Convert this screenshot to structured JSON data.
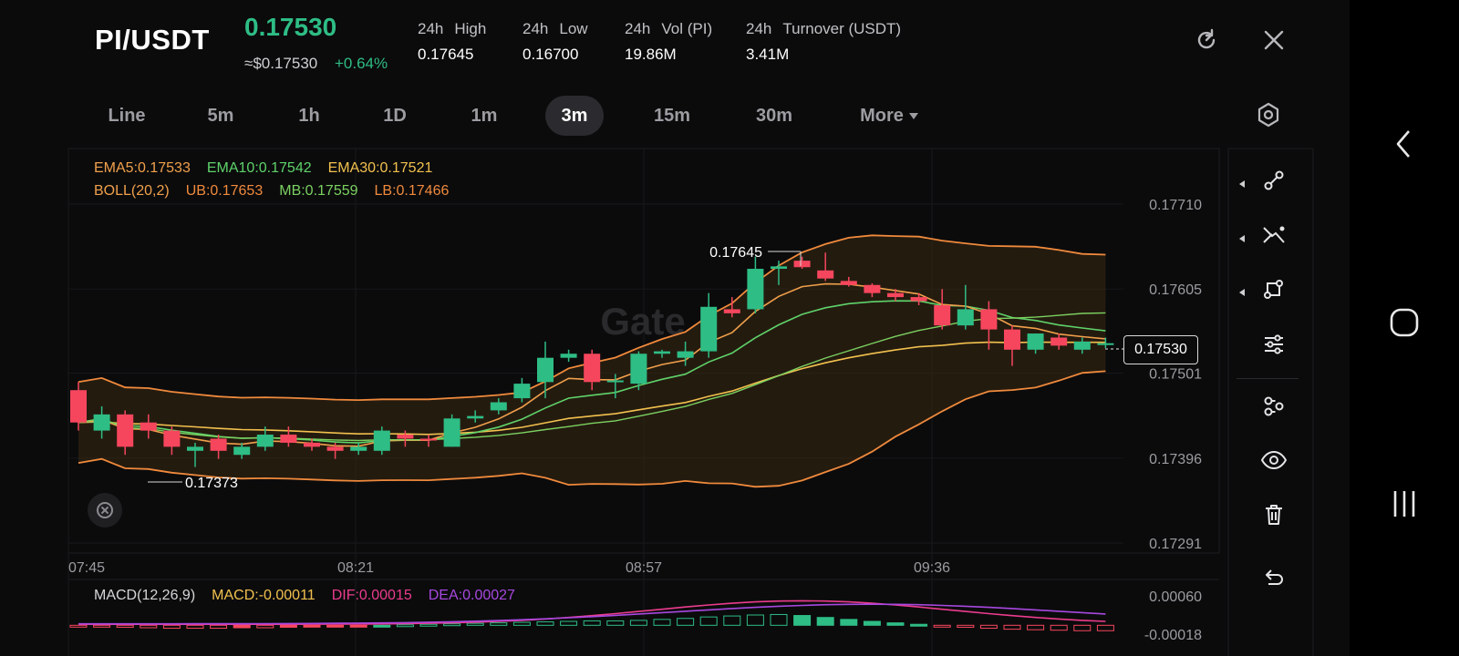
{
  "header": {
    "pair": "PI/USDT",
    "last_price": "0.17530",
    "approx_usd": "≈$0.17530",
    "change": "+0.64%",
    "stats": [
      {
        "label_a": "24h",
        "label_b": "High",
        "value": "0.17645"
      },
      {
        "label_a": "24h",
        "label_b": "Low",
        "value": "0.16700"
      },
      {
        "label_a": "24h",
        "label_b": "Vol (PI)",
        "value": "19.86M"
      },
      {
        "label_a": "24h",
        "label_b": "Turnover (USDT)",
        "value": "3.41M"
      }
    ],
    "icons": [
      "refresh-icon",
      "close-icon"
    ]
  },
  "tabs": {
    "items": [
      "Line",
      "5m",
      "1h",
      "1D",
      "1m",
      "3m",
      "15m",
      "30m",
      "More"
    ],
    "active": "3m"
  },
  "indicators": {
    "ema5": "EMA5:0.17533",
    "ema10": "EMA10:0.17542",
    "ema30": "EMA30:0.17521",
    "boll": "BOLL(20,2)",
    "ub": "UB:0.17653",
    "mb": "MB:0.17559",
    "lb": "LB:0.17466",
    "macd_name": "MACD(12,26,9)",
    "macd": "MACD:-0.00011",
    "dif": "DIF:0.00015",
    "dea": "DEA:0.00027"
  },
  "chart_data": {
    "type": "candlestick",
    "y_ticks": [
      "0.17710",
      "0.17605",
      "0.17501",
      "0.17396",
      "0.17291"
    ],
    "x_ticks": [
      "07:45",
      "08:21",
      "08:57",
      "09:36"
    ],
    "macd_ticks": [
      "0.00060",
      "-0.00018"
    ],
    "high_marker": "0.17645",
    "low_marker": "0.17373",
    "current_price": "0.17530",
    "watermark": "Gate",
    "colors": {
      "up": "#2ebd85",
      "down": "#f6465d",
      "ema5": "#f0a04b",
      "ema10": "#5fd36a",
      "ema30": "#f2c14e",
      "dif": "#ec3c8e",
      "dea": "#a848e0"
    },
    "candles": [
      {
        "o": 0.1748,
        "h": 0.1749,
        "l": 0.1743,
        "c": 0.1744
      },
      {
        "o": 0.1743,
        "h": 0.1746,
        "l": 0.1742,
        "c": 0.1745
      },
      {
        "o": 0.1745,
        "h": 0.17455,
        "l": 0.174,
        "c": 0.1741
      },
      {
        "o": 0.1744,
        "h": 0.1745,
        "l": 0.1742,
        "c": 0.1743
      },
      {
        "o": 0.1743,
        "h": 0.17435,
        "l": 0.174,
        "c": 0.1741
      },
      {
        "o": 0.17405,
        "h": 0.17415,
        "l": 0.17385,
        "c": 0.1741
      },
      {
        "o": 0.1742,
        "h": 0.17425,
        "l": 0.17395,
        "c": 0.17405
      },
      {
        "o": 0.174,
        "h": 0.17415,
        "l": 0.17395,
        "c": 0.1741
      },
      {
        "o": 0.1741,
        "h": 0.17435,
        "l": 0.17405,
        "c": 0.17425
      },
      {
        "o": 0.17425,
        "h": 0.17435,
        "l": 0.1741,
        "c": 0.17415
      },
      {
        "o": 0.17415,
        "h": 0.1742,
        "l": 0.17405,
        "c": 0.1741
      },
      {
        "o": 0.1741,
        "h": 0.17415,
        "l": 0.17395,
        "c": 0.17405
      },
      {
        "o": 0.17405,
        "h": 0.17415,
        "l": 0.174,
        "c": 0.1741
      },
      {
        "o": 0.17405,
        "h": 0.17435,
        "l": 0.174,
        "c": 0.1743
      },
      {
        "o": 0.17425,
        "h": 0.1743,
        "l": 0.1741,
        "c": 0.1742
      },
      {
        "o": 0.1742,
        "h": 0.17425,
        "l": 0.1741,
        "c": 0.17418
      },
      {
        "o": 0.1741,
        "h": 0.1745,
        "l": 0.1741,
        "c": 0.17445
      },
      {
        "o": 0.17445,
        "h": 0.17455,
        "l": 0.1744,
        "c": 0.17448
      },
      {
        "o": 0.17455,
        "h": 0.1747,
        "l": 0.1745,
        "c": 0.17465
      },
      {
        "o": 0.1747,
        "h": 0.17495,
        "l": 0.17465,
        "c": 0.17488
      },
      {
        "o": 0.1749,
        "h": 0.1754,
        "l": 0.1747,
        "c": 0.1752
      },
      {
        "o": 0.1752,
        "h": 0.1753,
        "l": 0.17515,
        "c": 0.17525
      },
      {
        "o": 0.17525,
        "h": 0.1753,
        "l": 0.1748,
        "c": 0.1749
      },
      {
        "o": 0.1749,
        "h": 0.175,
        "l": 0.1747,
        "c": 0.17492
      },
      {
        "o": 0.17488,
        "h": 0.17528,
        "l": 0.1748,
        "c": 0.17525
      },
      {
        "o": 0.17525,
        "h": 0.1753,
        "l": 0.1752,
        "c": 0.17528
      },
      {
        "o": 0.1752,
        "h": 0.1754,
        "l": 0.1751,
        "c": 0.17528
      },
      {
        "o": 0.17528,
        "h": 0.176,
        "l": 0.1752,
        "c": 0.17583
      },
      {
        "o": 0.1758,
        "h": 0.17595,
        "l": 0.1757,
        "c": 0.17575
      },
      {
        "o": 0.1758,
        "h": 0.17645,
        "l": 0.17575,
        "c": 0.1763
      },
      {
        "o": 0.1763,
        "h": 0.1764,
        "l": 0.1761,
        "c": 0.17633
      },
      {
        "o": 0.1764,
        "h": 0.17645,
        "l": 0.1763,
        "c": 0.17632
      },
      {
        "o": 0.17628,
        "h": 0.1765,
        "l": 0.17615,
        "c": 0.17618
      },
      {
        "o": 0.17615,
        "h": 0.1762,
        "l": 0.17608,
        "c": 0.1761
      },
      {
        "o": 0.1761,
        "h": 0.17612,
        "l": 0.17595,
        "c": 0.176
      },
      {
        "o": 0.176,
        "h": 0.17605,
        "l": 0.1759,
        "c": 0.17595
      },
      {
        "o": 0.17595,
        "h": 0.176,
        "l": 0.17585,
        "c": 0.1759
      },
      {
        "o": 0.17585,
        "h": 0.17605,
        "l": 0.17555,
        "c": 0.1756
      },
      {
        "o": 0.1756,
        "h": 0.1761,
        "l": 0.17555,
        "c": 0.1758
      },
      {
        "o": 0.1758,
        "h": 0.1759,
        "l": 0.1753,
        "c": 0.17555
      },
      {
        "o": 0.17555,
        "h": 0.1756,
        "l": 0.1751,
        "c": 0.1753
      },
      {
        "o": 0.1753,
        "h": 0.1755,
        "l": 0.17525,
        "c": 0.1755
      },
      {
        "o": 0.17545,
        "h": 0.1755,
        "l": 0.1753,
        "c": 0.17535
      },
      {
        "o": 0.1753,
        "h": 0.17545,
        "l": 0.17525,
        "c": 0.1754
      },
      {
        "o": 0.17538,
        "h": 0.17545,
        "l": 0.17532,
        "c": 0.17538
      }
    ],
    "macd_hist": [
      -2e-05,
      -3e-05,
      -4e-05,
      -5e-05,
      -6e-05,
      -6e-05,
      -6e-05,
      -5e-05,
      -5e-05,
      -4e-05,
      -3e-05,
      -2e-05,
      -1e-05,
      0.0,
      1e-05,
      2e-05,
      3e-05,
      4e-05,
      5e-05,
      6e-05,
      7e-05,
      8e-05,
      9e-05,
      9e-05,
      0.0001,
      0.00012,
      0.00014,
      0.00017,
      0.00019,
      0.00021,
      0.00022,
      0.0002,
      0.00016,
      0.00012,
      8e-05,
      5e-05,
      2e-05,
      -2e-05,
      -4e-05,
      -6e-05,
      -8e-05,
      -9e-05,
      -0.0001,
      -0.00011,
      -0.00011
    ]
  },
  "toolbar": {
    "icons": [
      "trendline-icon",
      "crossline-icon",
      "shape-tool-icon",
      "indicator-settings-icon",
      "layout-icon",
      "visibility-icon",
      "delete-icon",
      "undo-icon"
    ]
  },
  "top_right": {
    "settings_icon": "settings-hexagon-icon"
  },
  "sysnav": {
    "icons": [
      "back-icon",
      "home-icon",
      "recents-icon"
    ]
  }
}
